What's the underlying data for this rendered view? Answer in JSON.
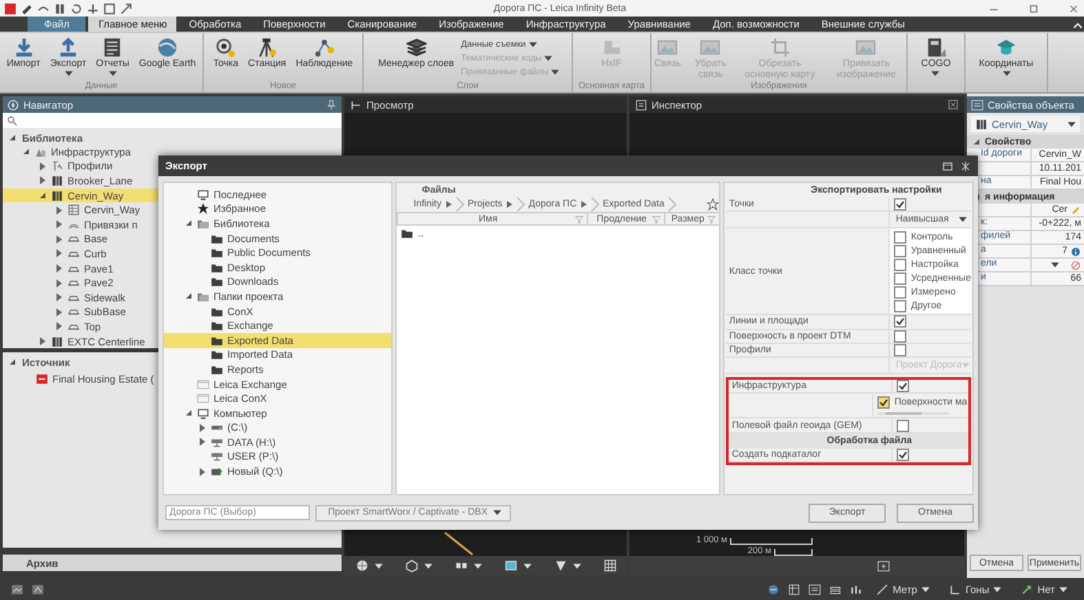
{
  "window": {
    "title": "Дорога ПС - Leica Infinity Beta"
  },
  "menu_tabs": [
    {
      "label": "Файл",
      "kind": "file",
      "selected": false
    },
    {
      "label": "Главное меню",
      "kind": "tab",
      "selected": true
    },
    {
      "label": "Обработка",
      "kind": "tab",
      "selected": false
    },
    {
      "label": "Поверхности",
      "kind": "tab",
      "selected": false
    },
    {
      "label": "Сканирование",
      "kind": "tab",
      "selected": false
    },
    {
      "label": "Изображение",
      "kind": "tab",
      "selected": false
    },
    {
      "label": "Инфраструктура",
      "kind": "tab",
      "selected": false
    },
    {
      "label": "Уравнивание",
      "kind": "tab",
      "selected": false
    },
    {
      "label": "Доп. возможности",
      "kind": "tab",
      "selected": false
    },
    {
      "label": "Внешние службы",
      "kind": "tab",
      "selected": false
    }
  ],
  "ribbon": {
    "groups": [
      {
        "label": "Данные",
        "items": [
          {
            "label": "Импорт",
            "kind": "large",
            "dropdown": false,
            "disabled": false
          },
          {
            "label": "Экспорт",
            "kind": "large",
            "dropdown": true,
            "disabled": false
          },
          {
            "label": "Отчеты",
            "kind": "large",
            "dropdown": true,
            "disabled": false
          },
          {
            "label": "Google Earth",
            "kind": "large",
            "dropdown": false,
            "disabled": false
          }
        ]
      },
      {
        "label": "Новое",
        "items": [
          {
            "label": "Точка",
            "kind": "large",
            "dropdown": false,
            "disabled": false
          },
          {
            "label": "Станция",
            "kind": "large",
            "dropdown": false,
            "disabled": false
          },
          {
            "label": "Наблюдение",
            "kind": "large",
            "dropdown": false,
            "disabled": false
          }
        ]
      },
      {
        "label": "Слои",
        "items": [
          {
            "label": "Менеджер слоев",
            "kind": "large",
            "dropdown": false,
            "disabled": false
          },
          {
            "label": "Данные съемки",
            "kind": "small",
            "dropdown": true,
            "disabled": false
          },
          {
            "label": "Тематические коды",
            "kind": "small",
            "dropdown": true,
            "disabled": true
          },
          {
            "label": "Привязанные файлы",
            "kind": "small",
            "dropdown": true,
            "disabled": true
          }
        ]
      },
      {
        "label": "Основная карта",
        "items": [
          {
            "label": "HxIF",
            "kind": "large",
            "dropdown": false,
            "disabled": true
          }
        ]
      },
      {
        "label": "Изображения",
        "items": [
          {
            "label": "Связь",
            "kind": "large",
            "dropdown": false,
            "disabled": true
          },
          {
            "label": "Убрать связь",
            "kind": "large",
            "dropdown": false,
            "disabled": true
          },
          {
            "label": "Обрезать основную карту",
            "kind": "large",
            "dropdown": false,
            "disabled": true
          },
          {
            "label": "Привязать изображение",
            "kind": "large",
            "dropdown": false,
            "disabled": true
          }
        ]
      },
      {
        "items": [
          {
            "label": "COGO",
            "kind": "large",
            "dropdown": true,
            "disabled": false
          }
        ]
      },
      {
        "items": [
          {
            "label": "Координаты",
            "kind": "large",
            "dropdown": true,
            "disabled": false
          }
        ]
      }
    ]
  },
  "navigator": {
    "title": "Навигатор",
    "library": {
      "title": "Библиотека",
      "expanded": true,
      "tree": [
        {
          "label": "Инфраструктура",
          "kind": "infra",
          "expanded": true,
          "selected": false,
          "children": [
            {
              "label": "Профили",
              "kind": "profile",
              "expanded": false,
              "selected": false
            },
            {
              "label": "Brooker_Lane",
              "kind": "road",
              "expanded": false,
              "selected": false
            },
            {
              "label": "Cervin_Way",
              "kind": "road",
              "expanded": true,
              "selected": true,
              "children": [
                {
                  "label": "Cervin_Way",
                  "kind": "alignment",
                  "expanded": false,
                  "selected": false
                },
                {
                  "label": "Привязки п",
                  "kind": "link",
                  "expanded": false,
                  "selected": false
                },
                {
                  "label": "Base",
                  "kind": "layer",
                  "expanded": false,
                  "selected": false
                },
                {
                  "label": "Curb",
                  "kind": "layer",
                  "expanded": false,
                  "selected": false
                },
                {
                  "label": "Pave1",
                  "kind": "layer",
                  "expanded": false,
                  "selected": false
                },
                {
                  "label": "Pave2",
                  "kind": "layer",
                  "expanded": false,
                  "selected": false
                },
                {
                  "label": "Sidewalk",
                  "kind": "layer",
                  "expanded": false,
                  "selected": false
                },
                {
                  "label": "SubBase",
                  "kind": "layer",
                  "expanded": false,
                  "selected": false
                },
                {
                  "label": "Top",
                  "kind": "layer",
                  "expanded": false,
                  "selected": false
                }
              ]
            },
            {
              "label": "EXTC Centerline",
              "kind": "road",
              "expanded": false,
              "selected": false
            }
          ]
        }
      ]
    },
    "sources": {
      "title": "Источник",
      "expanded": true,
      "items": [
        {
          "label": "Final Housing Estate (",
          "selected": false
        }
      ]
    },
    "archive": "Архив"
  },
  "view": {
    "panes": [
      {
        "title": "Просмотр"
      },
      {
        "title": "Инспектор"
      }
    ],
    "scale": [
      "1 000 м",
      "200 м"
    ]
  },
  "properties": {
    "title": "Свойства объекта",
    "object": "Cervin_Way",
    "sections": [
      {
        "title": "Свойство",
        "rows": [
          {
            "label": "Id дороги",
            "value": "Cervin_W",
            "kind": "text"
          },
          {
            "value": "10.11.201",
            "kind": "text"
          },
          {
            "label": "на",
            "value": "Final Hou",
            "kind": "text"
          }
        ]
      },
      {
        "title": "я информация",
        "rows": [
          {
            "value": "Cer",
            "kind": "edit"
          },
          {
            "label": "к:",
            "value": "-0+222, м",
            "kind": "text"
          },
          {
            "label": "филей",
            "value": "174",
            "kind": "text"
          },
          {
            "label": "а",
            "value": "7",
            "kind": "info"
          },
          {
            "label": "ели",
            "kind": "select"
          },
          {
            "label": "и",
            "value": "66",
            "kind": "text"
          }
        ]
      }
    ],
    "buttons": [
      "Отмена",
      "Применить"
    ]
  },
  "status_bar": {
    "items": [
      "Метр",
      "Гоны",
      "Нет"
    ]
  },
  "export_dialog": {
    "title": "Экспорт",
    "places": [
      {
        "label": "Последнее",
        "kind": "recent",
        "selected": false
      },
      {
        "label": "Избранное",
        "kind": "favorite",
        "selected": false
      },
      {
        "label": "Библиотека",
        "kind": "library",
        "expanded": true,
        "selected": false,
        "children": [
          {
            "label": "Documents",
            "kind": "folder",
            "selected": false
          },
          {
            "label": "Public Documents",
            "kind": "folder",
            "selected": false
          },
          {
            "label": "Desktop",
            "kind": "folder",
            "selected": false
          },
          {
            "label": "Downloads",
            "kind": "folder",
            "selected": false
          }
        ]
      },
      {
        "label": "Папки проекта",
        "kind": "library",
        "expanded": true,
        "selected": false,
        "children": [
          {
            "label": "ConX",
            "kind": "folder",
            "selected": false
          },
          {
            "label": "Exchange",
            "kind": "folder",
            "selected": false
          },
          {
            "label": "Exported Data",
            "kind": "folder",
            "selected": true
          },
          {
            "label": "Imported Data",
            "kind": "folder",
            "selected": false
          },
          {
            "label": "Reports",
            "kind": "folder",
            "selected": false
          }
        ]
      },
      {
        "label": "Leica Exchange",
        "kind": "leica",
        "selected": false
      },
      {
        "label": "Leica ConX",
        "kind": "leica",
        "selected": false
      },
      {
        "label": "Компьютер",
        "kind": "computer",
        "expanded": true,
        "selected": false,
        "children": [
          {
            "label": "(C:\\)",
            "kind": "drive",
            "expanded": false,
            "selected": false
          },
          {
            "label": "DATA (H:\\)",
            "kind": "network",
            "expanded": false,
            "selected": false
          },
          {
            "label": "USER (P:\\)",
            "kind": "network",
            "selected": false
          },
          {
            "label": "Новый (Q:\\)",
            "kind": "usb",
            "expanded": false,
            "selected": false
          }
        ]
      }
    ],
    "files": {
      "title": "Файлы",
      "breadcrumb": [
        {
          "label": "Infinity",
          "dropdown": true
        },
        {
          "label": "Projects",
          "dropdown": true
        },
        {
          "label": "Дорога ПС",
          "dropdown": true
        },
        {
          "label": "Exported Data",
          "dropdown": false
        }
      ],
      "columns": [
        "Имя",
        "Продление",
        "Размер"
      ],
      "rows": [
        {
          "name": ".."
        }
      ]
    },
    "settings": {
      "title": "Экспортировать настройки",
      "rows": [
        {
          "kind": "check",
          "label": "Точки",
          "checked": true,
          "highlighted": false
        },
        {
          "kind": "select",
          "value": "Наивысшая",
          "disabled": false,
          "highlighted": false
        },
        {
          "kind": "checklist",
          "label": "Класс точки",
          "highlighted": false,
          "options": [
            {
              "label": "Контроль",
              "checked": false
            },
            {
              "label": "Уравненный",
              "checked": false
            },
            {
              "label": "Настройка",
              "checked": false
            },
            {
              "label": "Усредненные",
              "checked": false
            },
            {
              "label": "Измерено",
              "checked": false
            },
            {
              "label": "Другое",
              "checked": false
            }
          ]
        },
        {
          "kind": "check",
          "label": "Линии и площади",
          "checked": true,
          "highlighted": false
        },
        {
          "kind": "check",
          "label": "Поверхность в проект DTM",
          "checked": false,
          "highlighted": false
        },
        {
          "kind": "check",
          "label": "Профили",
          "checked": false,
          "highlighted": false
        },
        {
          "kind": "select",
          "value": "Проект Дорога",
          "disabled": true,
          "highlighted": false
        },
        {
          "kind": "check",
          "label": "Инфраструктура",
          "checked": true,
          "highlighted": true
        },
        {
          "kind": "option",
          "label": "Поверхности ма",
          "checked": true,
          "highlighted": true
        },
        {
          "kind": "check",
          "label": "Полевой файл геоида (GEM)",
          "checked": false,
          "highlighted": true
        },
        {
          "kind": "section",
          "label": "Обработка файла",
          "highlighted": true
        },
        {
          "kind": "check",
          "label": "Создать подкаталог",
          "checked": true,
          "highlighted": true
        }
      ]
    },
    "file_name": "Дорога ПС (Выбор)",
    "format": "Проект SmartWorx / Captivate - DBX",
    "buttons": [
      "Экспорт",
      "Отмена"
    ]
  }
}
